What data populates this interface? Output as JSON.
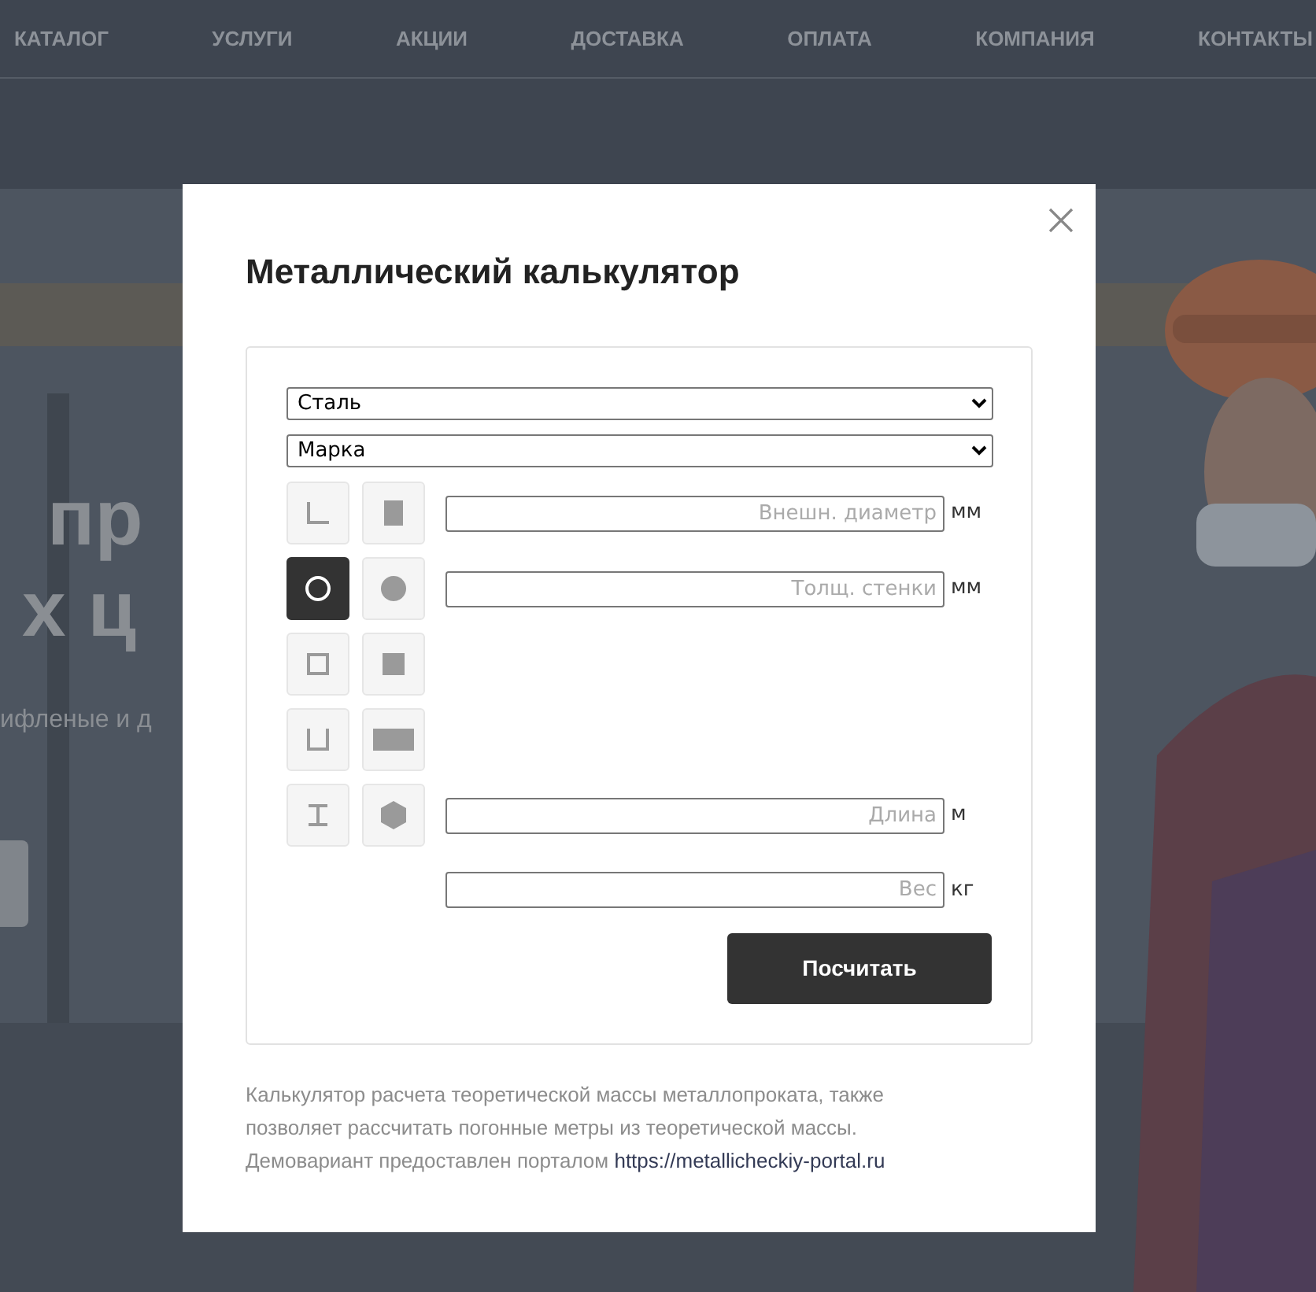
{
  "nav": [
    "КАТАЛОГ",
    "УСЛУГИ",
    "АКЦИИ",
    "ДОСТАВКА",
    "ОПЛАТА",
    "КОМПАНИЯ",
    "КОНТАКТЫ"
  ],
  "hero": {
    "lines": [
      "пр",
      "х ц"
    ],
    "subtitle": "ифленые и д"
  },
  "modal": {
    "title": "Металлический калькулятор",
    "selects": [
      "Сталь",
      "Марка"
    ],
    "rows": [
      {
        "shapes": [
          {
            "kind": "angle",
            "selected": false
          },
          {
            "kind": "strip",
            "selected": false
          }
        ],
        "field": {
          "placeholder": "Внешн. диаметр",
          "unit": "мм"
        }
      },
      {
        "shapes": [
          {
            "kind": "pipe",
            "selected": true
          },
          {
            "kind": "rod",
            "selected": false
          }
        ],
        "field": {
          "placeholder": "Толщ. стенки",
          "unit": "мм"
        }
      },
      {
        "shapes": [
          {
            "kind": "square-pipe",
            "selected": false
          },
          {
            "kind": "square",
            "selected": false
          }
        ]
      },
      {
        "shapes": [
          {
            "kind": "channel",
            "selected": false
          },
          {
            "kind": "sheet",
            "selected": false
          }
        ]
      },
      {
        "shapes": [
          {
            "kind": "beam",
            "selected": false
          },
          {
            "kind": "hexagon",
            "selected": false
          }
        ],
        "field": {
          "placeholder": "Длина",
          "unit": "м"
        }
      }
    ],
    "weight_field": {
      "placeholder": "Вес",
      "unit": "кг"
    },
    "button": "Посчитать",
    "note": "Калькулятор расчета теоретической массы металлопроката, также позволяет рассчитать погонные метры из теоретической массы. Демовариант предоставлен порталом",
    "link": "https://metallicheckiy-portal.ru"
  }
}
